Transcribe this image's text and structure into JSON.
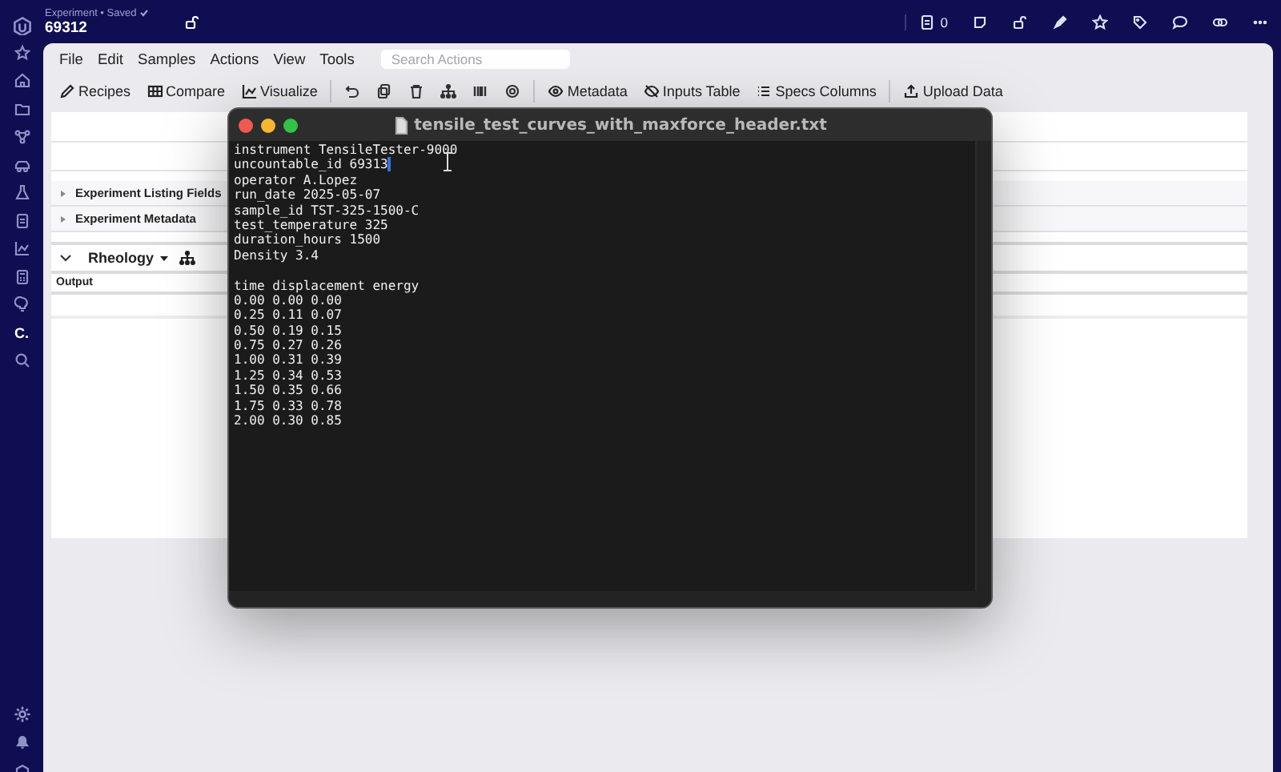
{
  "header": {
    "breadcrumb": "Experiment • Saved",
    "title": "69312",
    "count": "0"
  },
  "sidebar": {
    "label": "C."
  },
  "menu": [
    "File",
    "Edit",
    "Samples",
    "Actions",
    "View",
    "Tools"
  ],
  "search": {
    "placeholder": "Search Actions"
  },
  "toolbar": {
    "left": [
      "Recipes",
      "Compare",
      "Visualize"
    ],
    "right": [
      "Metadata",
      "Inputs Table",
      "Specs Columns"
    ],
    "end": [
      "Upload Data"
    ]
  },
  "sections": [
    {
      "label": "Experiment Listing Fields",
      "expanded": false
    },
    {
      "label": "Experiment Metadata",
      "expanded": false
    }
  ],
  "rheology": {
    "title": "Rheology",
    "expanded": true,
    "column": "Output"
  },
  "terminal": {
    "title": "tensile_test_curves_with_maxforce_header.txt",
    "lines": [
      {
        "text": "instrument TensileTester-9000",
        "cursor": false
      },
      {
        "text": "uncountable_id 69313",
        "cursor": true
      },
      {
        "text": "operator A.Lopez",
        "cursor": false
      },
      {
        "text": "run_date 2025-05-07",
        "cursor": false
      },
      {
        "text": "sample_id TST-325-1500-C",
        "cursor": false
      },
      {
        "text": "test_temperature 325",
        "cursor": false
      },
      {
        "text": "duration_hours 1500",
        "cursor": false
      },
      {
        "text": "Density 3.4",
        "cursor": false
      },
      {
        "kind": "blank"
      },
      {
        "text": "time displacement energy",
        "cursor": false
      },
      {
        "text": "0.00 0.00 0.00",
        "cursor": false
      },
      {
        "text": "0.25 0.11 0.07",
        "cursor": false
      },
      {
        "text": "0.50 0.19 0.15",
        "cursor": false
      },
      {
        "text": "0.75 0.27 0.26",
        "cursor": false
      },
      {
        "text": "1.00 0.31 0.39",
        "cursor": false
      },
      {
        "text": "1.25 0.34 0.53",
        "cursor": false
      },
      {
        "text": "1.50 0.35 0.66",
        "cursor": false
      },
      {
        "text": "1.75 0.33 0.78",
        "cursor": false
      },
      {
        "text": "2.00 0.30 0.85",
        "cursor": false
      }
    ]
  }
}
